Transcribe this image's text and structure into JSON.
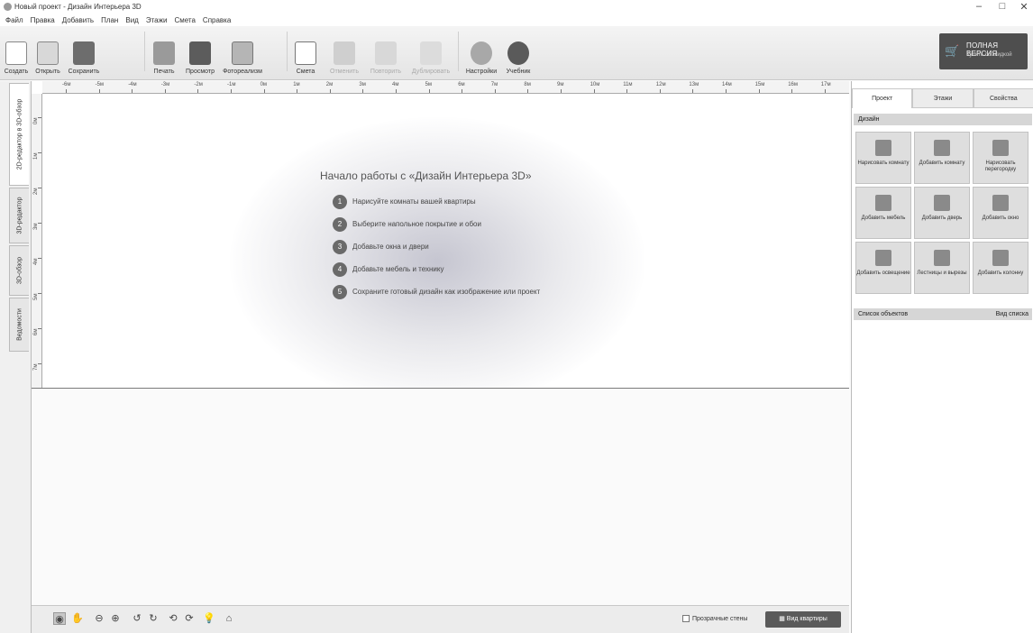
{
  "window": {
    "title": "Новый проект - Дизайн Интерьера 3D",
    "controls": {
      "minimize": "–",
      "maximize": "□",
      "close": "✕"
    }
  },
  "menu": [
    "Файл",
    "Правка",
    "Добавить",
    "План",
    "Вид",
    "Этажи",
    "Смета",
    "Справка"
  ],
  "toolbar": {
    "buttons": [
      {
        "label": "Создать",
        "icon": "new-file-icon",
        "enabled": true
      },
      {
        "label": "Открыть",
        "icon": "open-folder-icon",
        "enabled": true
      },
      {
        "label": "Сохранить",
        "icon": "save-icon",
        "enabled": true
      },
      {
        "label": "Печать",
        "icon": "printer-icon",
        "enabled": true
      },
      {
        "label": "Просмотр",
        "icon": "monitor-icon",
        "enabled": true
      },
      {
        "label": "Фотореализм",
        "icon": "photo-icon",
        "enabled": true
      },
      {
        "label": "Смета",
        "icon": "estimate-icon",
        "enabled": true
      },
      {
        "label": "Отменить",
        "icon": "undo-icon",
        "enabled": false
      },
      {
        "label": "Повторить",
        "icon": "redo-icon",
        "enabled": false
      },
      {
        "label": "Дублировать",
        "icon": "duplicate-icon",
        "enabled": false
      },
      {
        "label": "Настройки",
        "icon": "gear-icon",
        "enabled": true
      },
      {
        "label": "Учебник",
        "icon": "help-icon",
        "enabled": true
      }
    ],
    "buy": {
      "line1": "ПОЛНАЯ ВЕРСИЯ",
      "line2": "Купить со скидкой"
    }
  },
  "side_tabs": [
    "2D-редактор в 3D-обзор",
    "3D-редактор",
    "3D-обзор",
    "Ведомости"
  ],
  "ruler": {
    "h": [
      "-6м",
      "-5м",
      "-4м",
      "-3м",
      "-2м",
      "-1м",
      "0м",
      "1м",
      "2м",
      "3м",
      "4м",
      "5м",
      "6м",
      "7м",
      "8м",
      "9м",
      "10м",
      "11м",
      "12м",
      "13м",
      "14м",
      "15м",
      "16м",
      "17м"
    ],
    "v": [
      "0м",
      "1м",
      "2м",
      "3м",
      "4м",
      "5м",
      "6м",
      "7м"
    ]
  },
  "welcome": {
    "title": "Начало работы с «Дизайн Интерьера 3D»",
    "steps": [
      "Нарисуйте комнаты вашей квартиры",
      "Выберите напольное покрытие и обои",
      "Добавьте окна и двери",
      "Добавьте мебель и технику",
      "Сохраните готовый дизайн как изображение или проект"
    ]
  },
  "canvas_bar": {
    "transparent_walls": "Прозрачные стены",
    "floor_view": "Вид квартиры"
  },
  "right_panel": {
    "tabs": [
      "Проект",
      "Этажи",
      "Свойства"
    ],
    "design_header": "Дизайн",
    "tiles": [
      "Нарисовать комнату",
      "Добавить комнату",
      "Нарисовать перегородку",
      "Добавить мебель",
      "Добавить дверь",
      "Добавить окно",
      "Добавить освещение",
      "Лестницы и вырезы",
      "Добавить колонну"
    ],
    "objects_header": "Список объектов",
    "list_view": "Вид списка"
  }
}
